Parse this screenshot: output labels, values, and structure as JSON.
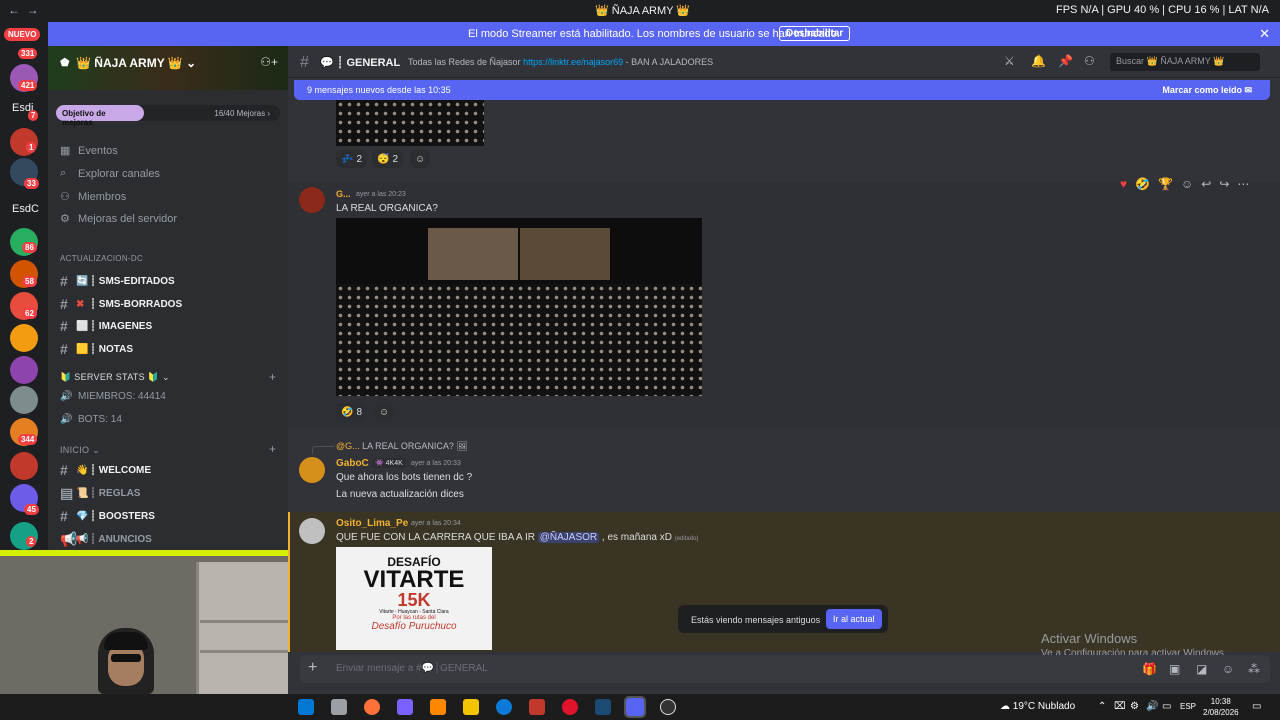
{
  "titlebar": {
    "back": "←",
    "forward": "→",
    "title": "👑 ÑAJA ARMY 👑",
    "stats": "FPS  N/A   |  GPU 40 %  |  CPU 16 %  |  LAT  N/A"
  },
  "rail": {
    "new_label": "NUEVO",
    "badges": [
      "331",
      "421",
      "7",
      "1",
      "33",
      "86",
      "58",
      "62",
      "344",
      "45",
      "2"
    ],
    "text_servers": [
      "Esdi",
      "EsdC"
    ]
  },
  "banner": {
    "message": "El modo Streamer está habilitado. Los nombres de usuario se han truncado.",
    "button": "Deshabilitar",
    "close": "✕"
  },
  "sidebar": {
    "guild_name": "👑 ÑAJA ARMY 👑 ⌄",
    "boost_goal": "Objetivo de mejoras",
    "boost_count": "16/40 Mejoras ›",
    "nav": [
      {
        "icon": "▦",
        "label": "Eventos"
      },
      {
        "icon": "⌕",
        "label": "Explorar canales"
      },
      {
        "icon": "⚇",
        "label": "Miembros"
      },
      {
        "icon": "⚙",
        "label": "Mejoras del servidor"
      }
    ],
    "cat_actualizacion": "ACTUALIZACION-DC",
    "channels_top": [
      {
        "emoji": "🔄",
        "label": "┊ SMS-EDITADOS"
      },
      {
        "emoji": "✖",
        "label": "┊ SMS-BORRADOS"
      },
      {
        "emoji": "⬜",
        "label": "┊ IMAGENES"
      },
      {
        "emoji": "🟨",
        "label": "┊ NOTAS"
      }
    ],
    "cat_stats": "🔰 SERVER STATS 🔰 ⌄",
    "stats": [
      "MIEMBROS: 44414",
      "BOTS: 14"
    ],
    "cat_inicio": "INICIO ⌄",
    "channels_inicio": [
      {
        "emoji": "👋",
        "label": "┊ WELCOME"
      },
      {
        "emoji": "📜",
        "label": "┊ REGLAS"
      },
      {
        "emoji": "💎",
        "label": "┊ BOOSTERS"
      },
      {
        "emoji": "📢",
        "label": "┊ ANUNCIOS"
      }
    ]
  },
  "header": {
    "channel": "┊ GENERAL",
    "topic_prefix": "Todas las Redes de Ñajasor",
    "topic_link": "https://linktr.ee/najasor69",
    "topic_suffix": " - BAN A JALADORES",
    "search_placeholder": "Buscar 👑 ÑAJA ARMY 👑"
  },
  "newbar": {
    "text": "9 mensajes nuevos desde las 10:35",
    "mark_read": "Marcar como leído ✉"
  },
  "messages": {
    "r1": [
      {
        "emoji": "💤",
        "count": "2"
      },
      {
        "emoji": "😴",
        "count": "2"
      }
    ],
    "m1": {
      "user": "G...",
      "time": "ayer a las 20:23",
      "text": "LA REAL ORGANICA?"
    },
    "r2": [
      {
        "emoji": "🤣",
        "count": "8"
      }
    ],
    "reply": {
      "user": "@G...",
      "text": "LA REAL ORGANICA? 🖼"
    },
    "m2": {
      "user": "GaboC",
      "tag": "👾 4K4K",
      "time": "ayer a las 20:33",
      "lines": [
        "Que ahora los bots tienen dc ?",
        "La nueva actualización dices"
      ]
    },
    "m3": {
      "user": "Osito_Lima_Pe",
      "time": "ayer a las 20:34",
      "text": "QUE FUE CON LA CARRERA QUE IBA A IR",
      "mention": "@ÑAJASOR",
      "text_after": " , es mañana xD",
      "edited": "(editado)"
    },
    "poster": {
      "line1": "DESAFÍO",
      "line2": "VITARTE",
      "line3": "15K",
      "line4": "Vitarte - Huaycan - Santa Clara",
      "line5": "Por las rutas del",
      "line6": "Desafío Puruchuco"
    }
  },
  "toast": {
    "text": "Estás viendo mensajes antiguos",
    "button": "Ir al actual"
  },
  "input": {
    "placeholder": "Enviar mensaje a #💬┊GENERAL"
  },
  "watermark": {
    "line1": "Activar Windows",
    "line2": "Ve a Configuración para activar Windows."
  },
  "taskbar": {
    "weather": "☁ 19°C  Nublado",
    "lang": "ESP",
    "time": "10:38",
    "date": "2/08/2026"
  },
  "colors": {
    "accent": "#5865f2",
    "gabo": "#f0b232",
    "osito": "#f0b232",
    "bg": "#313338"
  }
}
